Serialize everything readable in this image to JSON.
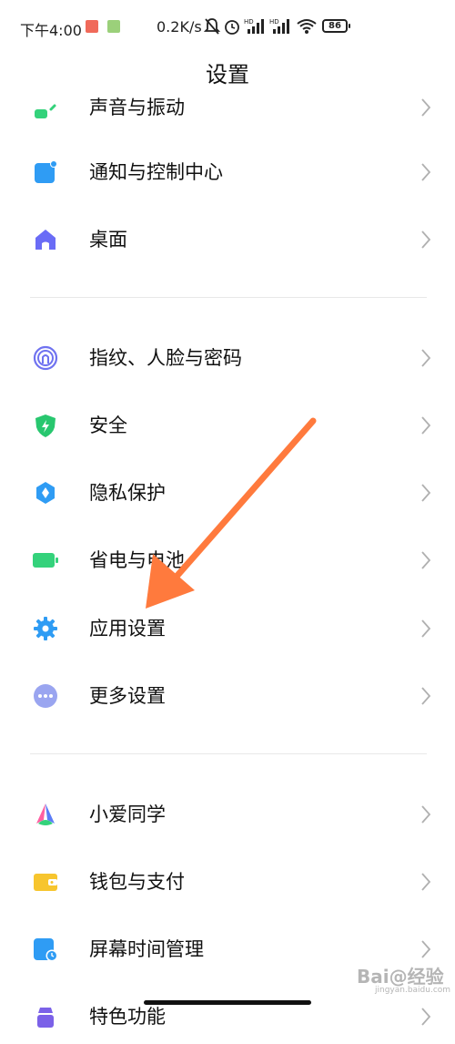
{
  "status_bar": {
    "time": "下午4:00",
    "network_speed": "0.2K/s",
    "battery": "86",
    "icons": [
      "red-notification-icon",
      "green-notification-icon",
      "mute-bell-icon",
      "alarm-icon",
      "signal-hd-1-icon",
      "signal-hd-2-icon",
      "wifi-icon",
      "battery-icon"
    ]
  },
  "header": {
    "title": "设置"
  },
  "groups": [
    {
      "items": [
        {
          "label": "声音与振动",
          "icon": "sound-icon",
          "color": "#34d27b"
        },
        {
          "label": "通知与控制中心",
          "icon": "notification-icon",
          "color": "#2f9cf4"
        },
        {
          "label": "桌面",
          "icon": "home-icon",
          "color": "#6a6cf6"
        }
      ]
    },
    {
      "items": [
        {
          "label": "指纹、人脸与密码",
          "icon": "fingerprint-icon",
          "color": "#6f72f0"
        },
        {
          "label": "安全",
          "icon": "shield-icon",
          "color": "#28c76f"
        },
        {
          "label": "隐私保护",
          "icon": "privacy-icon",
          "color": "#2f9cf4"
        },
        {
          "label": "省电与电池",
          "icon": "battery-saver-icon",
          "color": "#34d27b"
        },
        {
          "label": "应用设置",
          "icon": "gear-icon",
          "color": "#2f9cf4"
        },
        {
          "label": "更多设置",
          "icon": "more-icon",
          "color": "#9aa5f0"
        }
      ]
    },
    {
      "items": [
        {
          "label": "小爱同学",
          "icon": "xiaoai-icon",
          "color": "#5b7cf7"
        },
        {
          "label": "钱包与支付",
          "icon": "wallet-icon",
          "color": "#f7c52e"
        },
        {
          "label": "屏幕时间管理",
          "icon": "screen-time-icon",
          "color": "#2f9cf4"
        },
        {
          "label": "特色功能",
          "icon": "features-icon",
          "color": "#7b61e8"
        }
      ]
    }
  ],
  "annotation": {
    "color": "#ff7a3d"
  },
  "watermark": {
    "text": "Bai@经验",
    "sub": "jingyan.baidu.com"
  }
}
